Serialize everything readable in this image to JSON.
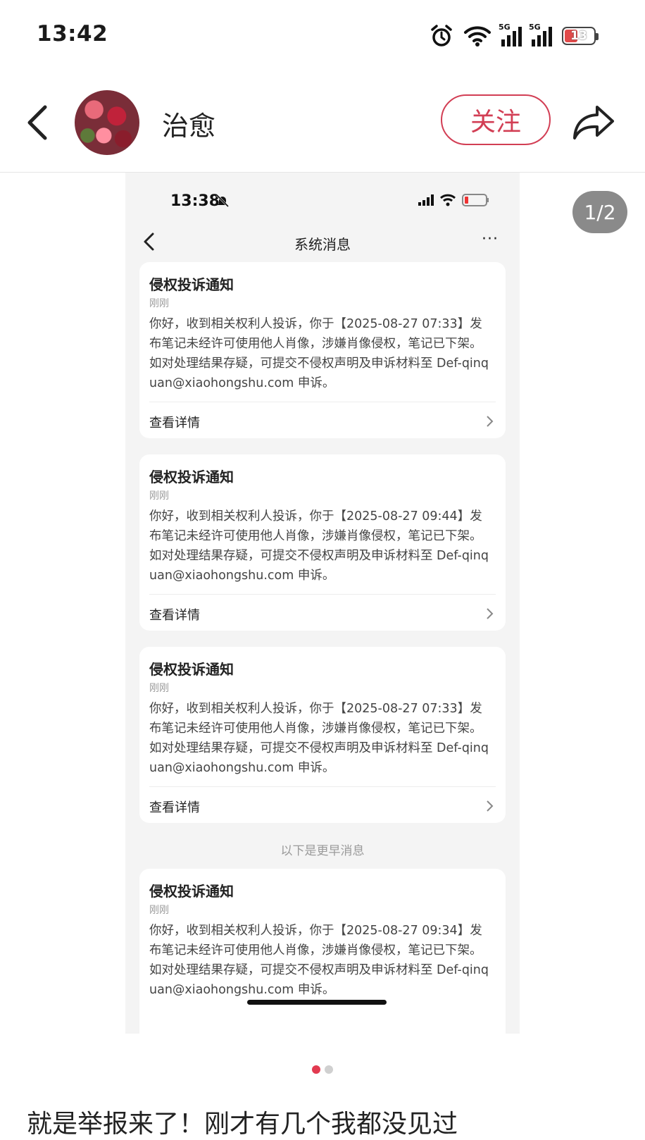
{
  "status_bar": {
    "time": "13:42",
    "battery": "13",
    "network_tag": "5G"
  },
  "header": {
    "username": "治愈",
    "follow_label": "关注"
  },
  "image_counter": "1/2",
  "screenshot": {
    "status_time": "13:38",
    "nav_title": "系统消息",
    "nav_more": "···",
    "earlier_label": "以下是更早消息",
    "notifications": [
      {
        "title": "侵权投诉通知",
        "time": "刚刚",
        "body": "你好，收到相关权利人投诉，你于【2025-08-27 07:33】发布笔记未经许可使用他人肖像，涉嫌肖像侵权，笔记已下架。如对处理结果存疑，可提交不侵权声明及申诉材料至 Def-qinquan@xiaohongshu.com 申诉。",
        "link": "查看详情"
      },
      {
        "title": "侵权投诉通知",
        "time": "刚刚",
        "body": "你好，收到相关权利人投诉，你于【2025-08-27 09:44】发布笔记未经许可使用他人肖像，涉嫌肖像侵权，笔记已下架。如对处理结果存疑，可提交不侵权声明及申诉材料至 Def-qinquan@xiaohongshu.com 申诉。",
        "link": "查看详情"
      },
      {
        "title": "侵权投诉通知",
        "time": "刚刚",
        "body": "你好，收到相关权利人投诉，你于【2025-08-27 07:33】发布笔记未经许可使用他人肖像，涉嫌肖像侵权，笔记已下架。如对处理结果存疑，可提交不侵权声明及申诉材料至 Def-qinquan@xiaohongshu.com 申诉。",
        "link": "查看详情"
      },
      {
        "title": "侵权投诉通知",
        "time": "刚刚",
        "body": "你好，收到相关权利人投诉，你于【2025-08-27 09:34】发布笔记未经许可使用他人肖像，涉嫌肖像侵权，笔记已下架。如对处理结果存疑，可提交不侵权声明及申诉材料至 Def-qinquan@xiaohongshu.com 申诉。"
      }
    ]
  },
  "caption": "就是举报来了！刚才有几个我都没见过"
}
